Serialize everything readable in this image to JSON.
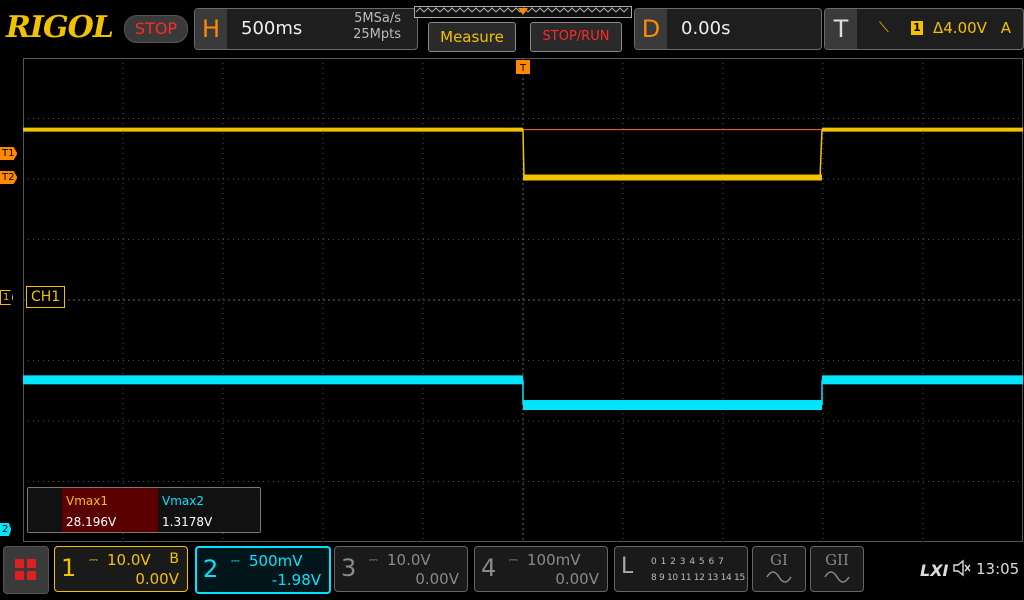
{
  "brand": "RIGOL",
  "run_state": "STOP",
  "horizontal": {
    "letter": "H",
    "timebase": "500ms",
    "sample_rate": "5MSa/s",
    "memory_depth": "25Mpts"
  },
  "buttons": {
    "measure": "Measure",
    "stop_run": "STOP/RUN"
  },
  "delay": {
    "letter": "D",
    "value": "0.00s"
  },
  "trigger": {
    "letter": "T",
    "source": "1",
    "level": "Δ4.00V",
    "mode": "A"
  },
  "markers": {
    "t1": "T1",
    "t2": "T2",
    "ch1": "1",
    "ch2": "2",
    "ch1_label": "CH1",
    "trig_pos": "T"
  },
  "measurements": {
    "m1_name": "Vmax1",
    "m1_value": "28.196V",
    "m2_name": "Vmax2",
    "m2_value": "1.3178V"
  },
  "channels": [
    {
      "num": "1",
      "coupling": "⎓",
      "scale": "10.0V",
      "bw": "B",
      "offset": "0.00V"
    },
    {
      "num": "2",
      "coupling": "⎓",
      "scale": "500mV",
      "bw": "",
      "offset": "-1.98V"
    },
    {
      "num": "3",
      "coupling": "⎓",
      "scale": "10.0V",
      "bw": "",
      "offset": "0.00V"
    },
    {
      "num": "4",
      "coupling": "⎓",
      "scale": "100mV",
      "bw": "",
      "offset": "0.00V"
    }
  ],
  "logic": {
    "letter": "L",
    "row1": "0 1 2 3   4 5 6 7",
    "row2": "8 9 10 11  12 13 14 15"
  },
  "generators": {
    "g1": "GI",
    "g2": "GII"
  },
  "status": {
    "lxi": "LXI",
    "time": "13:05"
  },
  "colors": {
    "ch1": "#f2c200",
    "ch2": "#00e5ff",
    "trigger_marker": "#ff8a00",
    "stop": "#ff2a2a"
  },
  "waveforms": {
    "ch1_high_frac": 0.148,
    "ch1_low_frac": 0.249,
    "ch1_edge_fall_frac": 0.5,
    "ch1_edge_rise_frac": 0.799,
    "ch2_high_frac": 0.666,
    "ch2_low_frac": 0.717
  }
}
